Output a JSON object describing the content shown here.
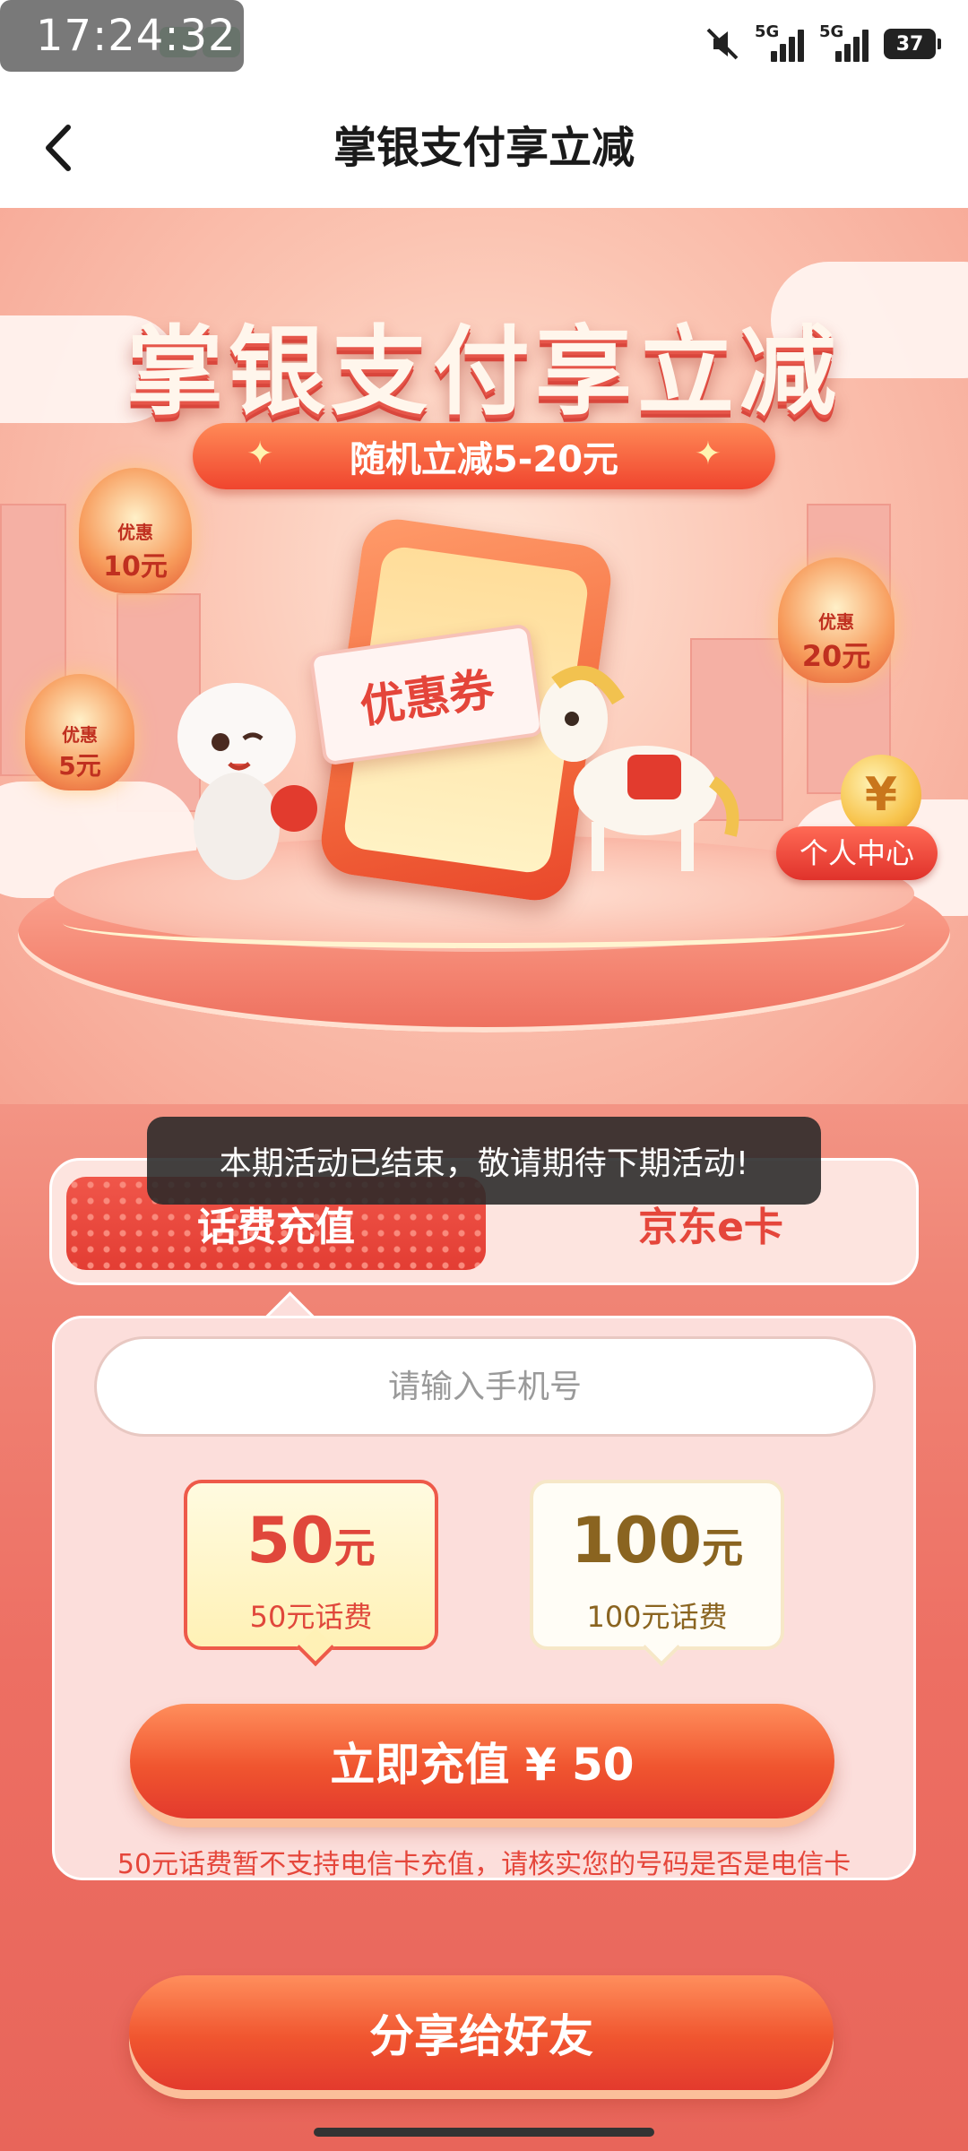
{
  "status_bar": {
    "time": "17:24:32",
    "network1": "5G",
    "network2": "5G",
    "battery": "37"
  },
  "nav": {
    "title": "掌银支付享立减",
    "back_icon": "chevron-left-icon"
  },
  "hero": {
    "title": "掌银支付享立减",
    "ribbon": "随机立减5-20元",
    "coupon_text": "优惠券",
    "lanterns": [
      {
        "label": "优惠",
        "amount": "10元"
      },
      {
        "label": "优惠",
        "amount": "20元"
      },
      {
        "label": "优惠",
        "amount": "5元"
      }
    ],
    "personal_center": "个人中心",
    "coin_symbol": "¥"
  },
  "toast": "本期活动已结束，敬请期待下期活动!",
  "tabs": {
    "items": [
      {
        "label": "话费充值",
        "active": true
      },
      {
        "label": "京东e卡",
        "active": false
      }
    ]
  },
  "form": {
    "phone_placeholder": "请输入手机号",
    "amounts": [
      {
        "value": "50",
        "unit": "元",
        "sub": "50元话费",
        "selected": true
      },
      {
        "value": "100",
        "unit": "元",
        "sub": "100元话费",
        "selected": false
      }
    ],
    "recharge_button": "立即充值 ¥ 50",
    "notice": "50元话费暂不支持电信卡充值，请核实您的号码是否是电信卡"
  },
  "share_button": "分享给好友",
  "colors": {
    "accent": "#e5463b",
    "button_start": "#ff8e5c",
    "button_end": "#e33a2d"
  }
}
